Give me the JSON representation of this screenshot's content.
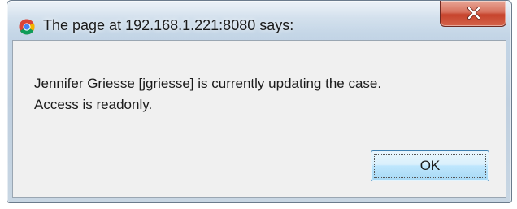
{
  "dialog": {
    "title": "The page at 192.168.1.221:8080 says:",
    "title_icon": "chrome-icon",
    "close_icon": "close-icon",
    "message_line1": "Jennifer Griesse [jgriesse] is currently updating the case.",
    "message_line2": "Access is readonly.",
    "ok_label": "OK"
  },
  "colors": {
    "frame": "#c3d5e6",
    "content_bg": "#f0f0f0",
    "close_button": "#c6432c",
    "ok_button_border": "#3c7fb1"
  }
}
